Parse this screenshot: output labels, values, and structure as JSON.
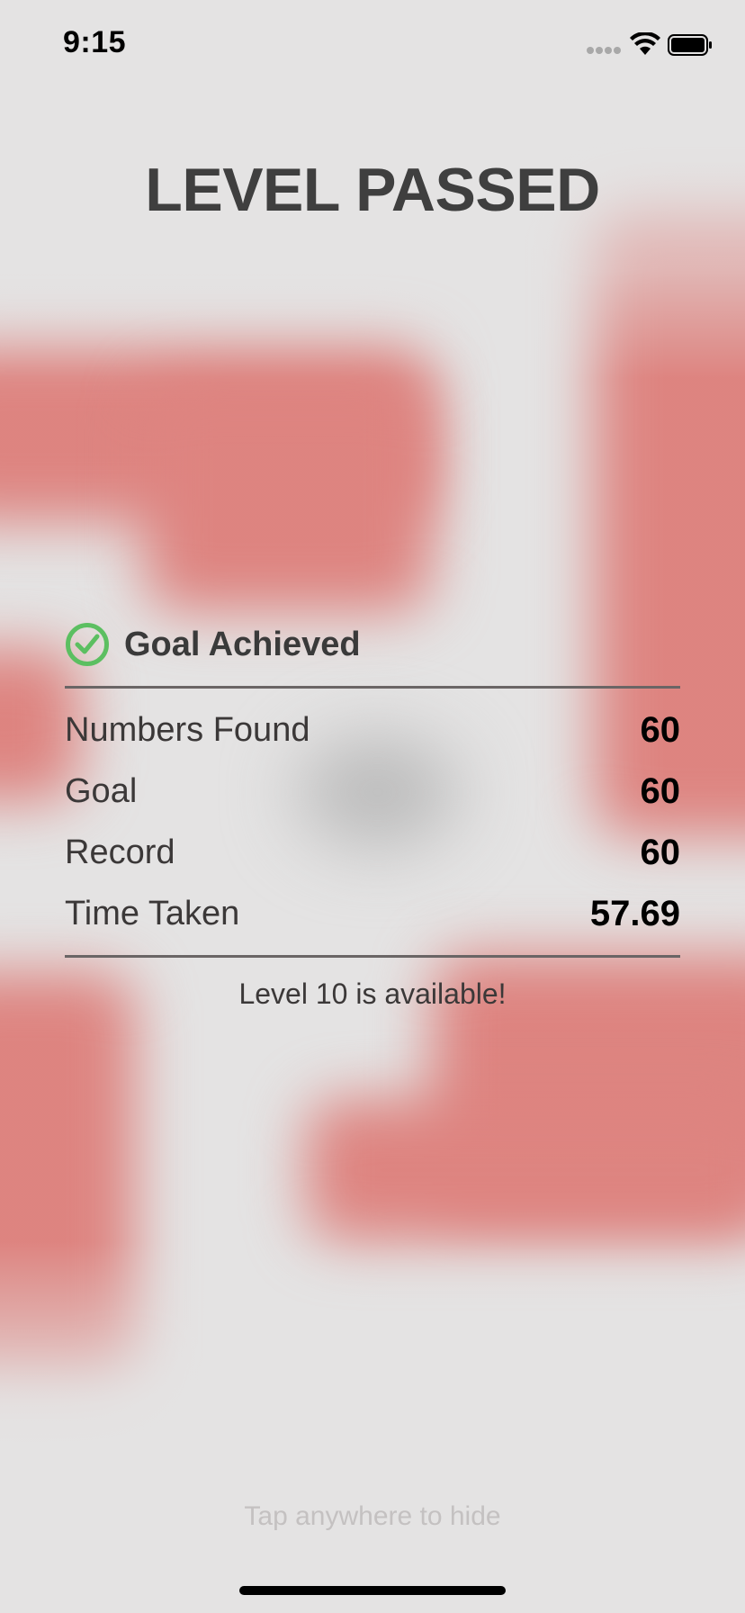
{
  "status_bar": {
    "time": "9:15"
  },
  "title": "LEVEL PASSED",
  "goal": {
    "icon": "check-circle-icon",
    "label": "Goal Achieved",
    "accent_color": "#5cbf61"
  },
  "stats": [
    {
      "label": "Numbers Found",
      "value": "60"
    },
    {
      "label": "Goal",
      "value": "60"
    },
    {
      "label": "Record",
      "value": "60"
    },
    {
      "label": "Time Taken",
      "value": "57.69"
    }
  ],
  "unlock_message": "Level 10 is available!",
  "hint": "Tap anywhere to hide",
  "colors": {
    "background": "#e4e3e3",
    "tile": "#dd7f7b",
    "title_text": "#3f3f3f"
  }
}
